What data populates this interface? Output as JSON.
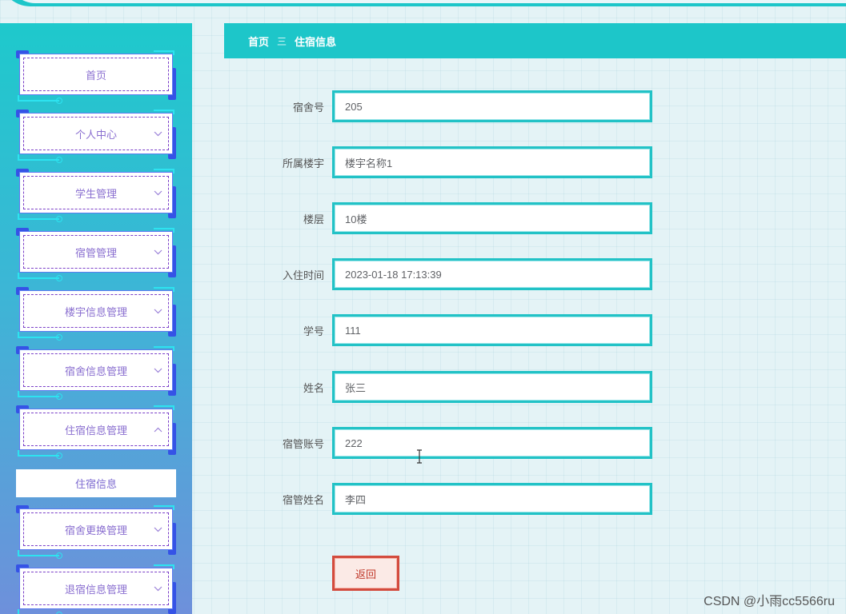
{
  "sidebar": {
    "items": [
      {
        "label": "首页",
        "has_chevron": false
      },
      {
        "label": "个人中心",
        "has_chevron": true,
        "chevron": "down"
      },
      {
        "label": "学生管理",
        "has_chevron": true,
        "chevron": "down"
      },
      {
        "label": "宿管管理",
        "has_chevron": true,
        "chevron": "down"
      },
      {
        "label": "楼宇信息管理",
        "has_chevron": true,
        "chevron": "down"
      },
      {
        "label": "宿舍信息管理",
        "has_chevron": true,
        "chevron": "down"
      },
      {
        "label": "住宿信息管理",
        "has_chevron": true,
        "chevron": "up",
        "expanded": true
      },
      {
        "label": "宿舍更换管理",
        "has_chevron": true,
        "chevron": "down"
      },
      {
        "label": "退宿信息管理",
        "has_chevron": true,
        "chevron": "down"
      }
    ],
    "submenu": {
      "label": "住宿信息"
    }
  },
  "breadcrumb": {
    "home": "首页",
    "separator": "三",
    "current": "住宿信息"
  },
  "form": {
    "fields": [
      {
        "label": "宿舍号",
        "value": "205"
      },
      {
        "label": "所属楼宇",
        "value": "楼宇名称1"
      },
      {
        "label": "楼层",
        "value": "10楼"
      },
      {
        "label": "入住时间",
        "value": "2023-01-18 17:13:39"
      },
      {
        "label": "学号",
        "value": "111"
      },
      {
        "label": "姓名",
        "value": "张三"
      },
      {
        "label": "宿管账号",
        "value": "222"
      },
      {
        "label": "宿管姓名",
        "value": "李四"
      }
    ],
    "back_label": "返回"
  },
  "watermark": "CSDN @小雨cc5566ru",
  "colors": {
    "accent": "#1dc6c9",
    "menu_text": "#8a6fd0",
    "back_border": "#d34b3d"
  }
}
